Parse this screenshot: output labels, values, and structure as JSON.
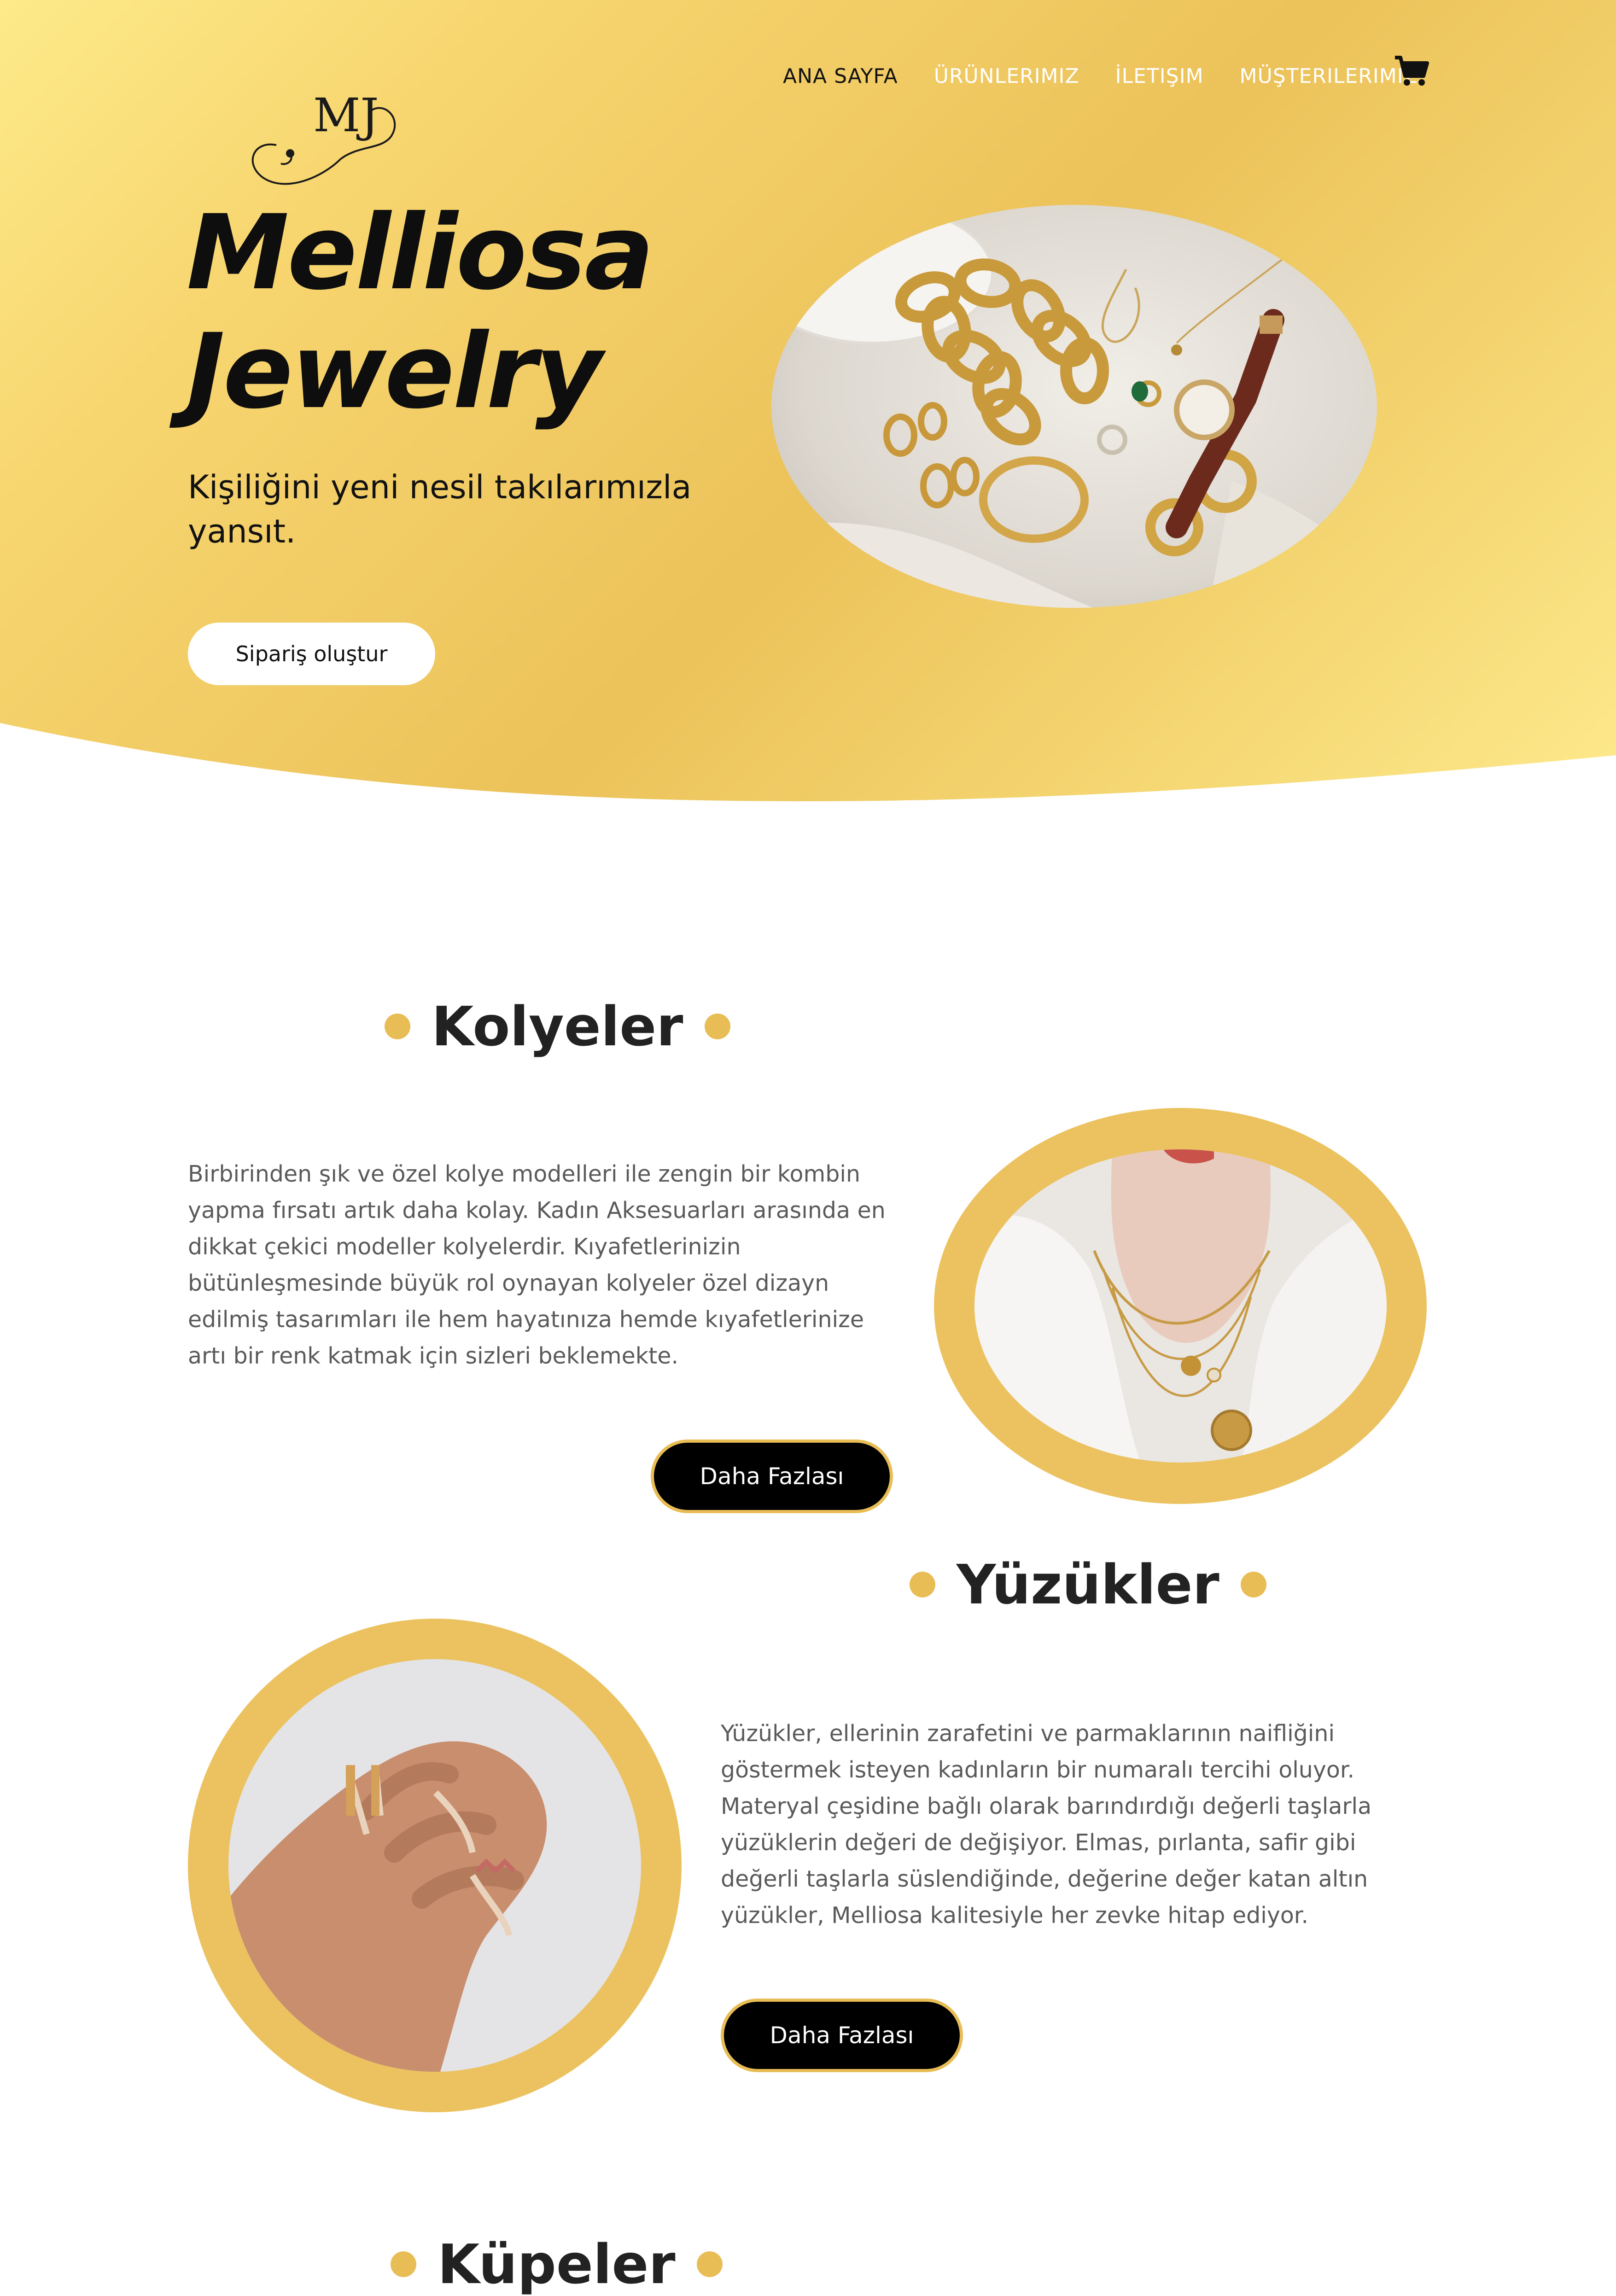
{
  "nav": {
    "items": [
      {
        "label": "ANA SAYFA"
      },
      {
        "label": "ÜRÜNLERIMIZ"
      },
      {
        "label": "İLETIŞIM"
      },
      {
        "label": "MÜŞTERILERIMIZ"
      }
    ],
    "cart_icon": "shopping-cart-icon"
  },
  "hero": {
    "logo_text": "MJ",
    "title_line1": "Melliosa",
    "title_line2": "Jewelry",
    "subtitle": "Kişiliğini yeni nesil takılarımızla yansıt.",
    "cta_label": "Sipariş oluştur"
  },
  "sections": {
    "necklaces": {
      "heading": "Kolyeler",
      "text": "Birbirinden şık ve özel kolye modelleri ile zengin bir kombin yapma fırsatı artık daha kolay. Kadın Aksesuarları arasında en dikkat çekici modeller kolyelerdir. Kıyafetlerinizin bütünleşmesinde büyük rol oynayan kolyeler özel dizayn edilmiş tasarımları ile hem hayatınıza hemde kıyafetlerinize artı bir renk katmak için sizleri beklemekte.",
      "button": "Daha Fazlası"
    },
    "rings": {
      "heading": "Yüzükler",
      "text": "Yüzükler, ellerinin zarafetini ve parmaklarının naifliğini göstermek isteyen kadınların bir numaralı tercihi oluyor. Materyal çeşidine bağlı olarak barındırdığı değerli taşlarla yüzüklerin değeri de değişiyor. Elmas, pırlanta, safir gibi değerli taşlarla süslendiğinde, değerine değer katan altın yüzükler, Melliosa kalitesiyle her zevke hitap ediyor.",
      "button": "Daha Fazlası"
    },
    "earrings": {
      "heading": "Küpeler"
    }
  },
  "colors": {
    "accent": "#e9bd55",
    "hero_light": "#fdea89",
    "hero_dark": "#ecc25a",
    "text_dark": "#111111",
    "text_body": "#5a5a5a"
  }
}
